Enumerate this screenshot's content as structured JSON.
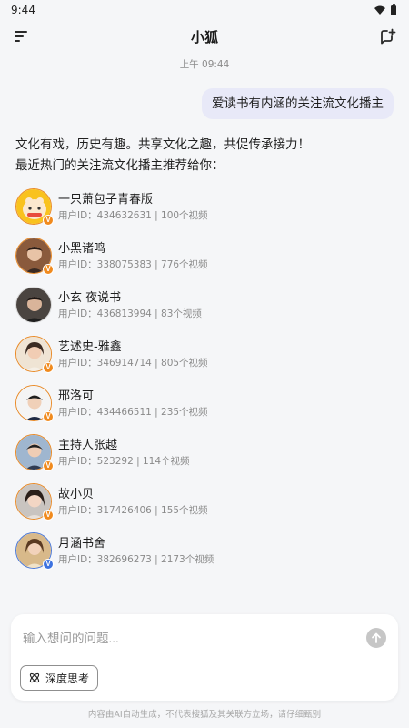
{
  "status_bar": {
    "time": "9:44"
  },
  "header": {
    "title": "小狐"
  },
  "chat": {
    "timestamp": "上午 09:44",
    "user_message": "爱读书有内涵的关注流文化播主",
    "reply_line1": "文化有戏，历史有趣。共享文化之趣，共促传承接力！",
    "reply_line2": "最近热门的关注流文化播主推荐给你：",
    "streamers": [
      {
        "name": "一只萧包子青春版",
        "meta": "用户ID：434632631 | 100个视频",
        "badge": "V",
        "badge_color": "#f08a1e"
      },
      {
        "name": "小黑诸鸣",
        "meta": "用户ID：338075383 | 776个视频",
        "badge": "V",
        "badge_color": "#f08a1e"
      },
      {
        "name": "小玄 夜说书",
        "meta": "用户ID：436813994 | 83个视频",
        "badge": "",
        "badge_color": ""
      },
      {
        "name": "艺述史-雅鑫",
        "meta": "用户ID：346914714 | 805个视频",
        "badge": "V",
        "badge_color": "#f08a1e"
      },
      {
        "name": "邢洛可",
        "meta": "用户ID：434466511 | 235个视频",
        "badge": "V",
        "badge_color": "#f08a1e"
      },
      {
        "name": "主持人张越",
        "meta": "用户ID：523292 | 114个视频",
        "badge": "V",
        "badge_color": "#f08a1e"
      },
      {
        "name": "故小贝",
        "meta": "用户ID：317426406 | 155个视频",
        "badge": "V",
        "badge_color": "#f08a1e"
      },
      {
        "name": "月涵书舍",
        "meta": "用户ID：382696273 | 2173个视频",
        "badge": "V",
        "badge_color": "#3d72e0"
      }
    ]
  },
  "composer": {
    "placeholder": "输入想问的问题...",
    "deep_think_label": "深度思考"
  },
  "footer": {
    "disclaimer": "内容由AI自动生成，不代表搜狐及其关联方立场，请仔细甄别"
  },
  "colors": {
    "accent_bubble": "#e8e9f8",
    "badge_orange": "#f08a1e",
    "badge_blue": "#3d72e0"
  }
}
